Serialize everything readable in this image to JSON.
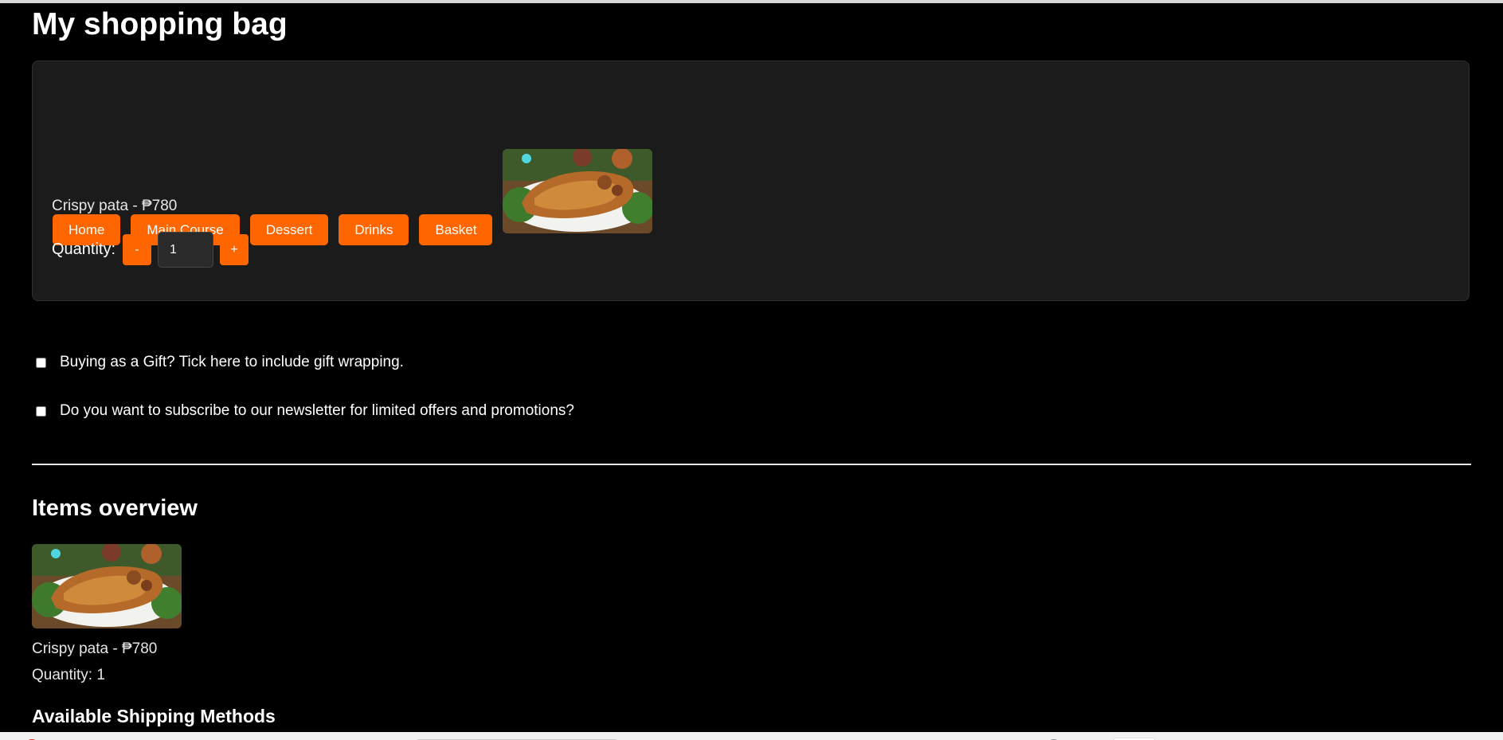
{
  "page": {
    "title": "My shopping bag"
  },
  "nav": {
    "items": [
      {
        "label": "Home"
      },
      {
        "label": "Main Course"
      },
      {
        "label": "Dessert"
      },
      {
        "label": "Drinks"
      },
      {
        "label": "Basket"
      }
    ]
  },
  "bag": {
    "item_text": "Crispy pata - ₱780",
    "quantity_label": "Quantity:",
    "decrement_label": "-",
    "increment_label": "+",
    "quantity_value": "1",
    "image_alt": "Crispy pata"
  },
  "options": {
    "gift_label": "Buying as a Gift? Tick here to include gift wrapping.",
    "gift_checked": false,
    "newsletter_label": "Do you want to subscribe to our newsletter for limited offers and promotions?",
    "newsletter_checked": false
  },
  "overview": {
    "heading": "Items overview",
    "item_text": "Crispy pata - ₱780",
    "quantity_text": "Quantity: 1"
  },
  "shipping": {
    "heading": "Available Shipping Methods"
  },
  "colors": {
    "accent": "#ff6600",
    "background": "#000000",
    "card": "#1b1b1b"
  }
}
